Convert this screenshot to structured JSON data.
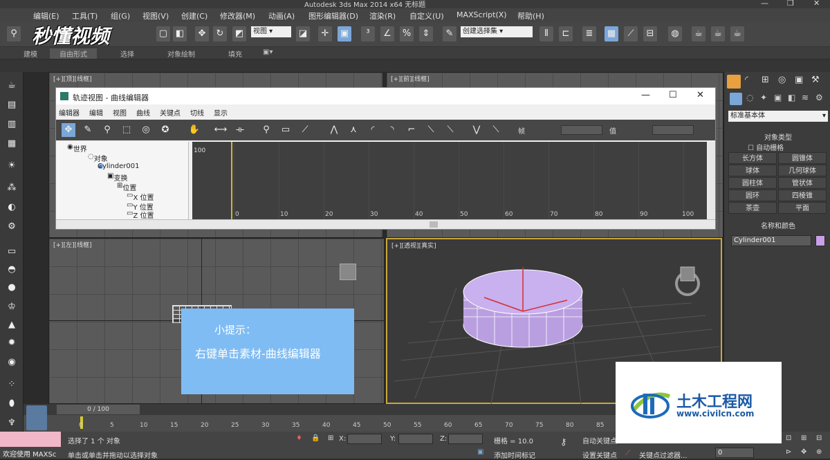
{
  "window": {
    "title": "Autodesk 3ds Max  2014 x64      无标题"
  },
  "menu": [
    "编辑(E)",
    "工具(T)",
    "组(G)",
    "视图(V)",
    "创建(C)",
    "修改器(M)",
    "动画(A)",
    "图形编辑器(D)",
    "渲染(R)",
    "自定义(U)",
    "MAXScript(X)",
    "帮助(H)"
  ],
  "toolbar": {
    "view_dropdown": "视图",
    "selection_set": "创建选择集"
  },
  "ribbon": {
    "tabs": [
      "建模",
      "自由形式",
      "选择",
      "对象绘制",
      "填充"
    ]
  },
  "watermark": "秒懂视频",
  "viewports": {
    "top_left": "[+][顶][线框]",
    "top_right": "[+][前][线框]",
    "bottom_left": "[+][左][线框]",
    "bottom_right": "[+][透视][真实]"
  },
  "dialog": {
    "title": "轨迹视图 - 曲线编辑器",
    "menu": [
      "编辑器",
      "编辑",
      "视图",
      "曲线",
      "关键点",
      "切线",
      "显示"
    ],
    "field_frame": "帧",
    "field_value": "值",
    "tree": [
      "世界",
      "对象",
      "Cylinder001",
      "变换",
      "位置",
      "X 位置",
      "Y 位置",
      "Z 位置"
    ],
    "y_label": "100",
    "x_ticks": [
      "0",
      "10",
      "20",
      "30",
      "40",
      "50",
      "60",
      "70",
      "80",
      "90",
      "100"
    ]
  },
  "tip": {
    "line1": "小提示：",
    "line2": "右键单击素材-曲线编辑器"
  },
  "command_panel": {
    "dropdown": "标准基本体",
    "section_object_type": "对象类型",
    "autogrid": "自动栅格",
    "buttons": [
      "长方体",
      "圆锥体",
      "球体",
      "几何球体",
      "圆柱体",
      "管状体",
      "圆环",
      "四棱锥",
      "茶壶",
      "平面"
    ],
    "section_name_color": "名称和颜色",
    "object_name": "Cylinder001",
    "object_color": "#c9a0e8"
  },
  "timeline": {
    "frame": "0 / 100",
    "ticks": [
      "0",
      "5",
      "10",
      "15",
      "20",
      "25",
      "30",
      "35",
      "40",
      "45",
      "50",
      "55",
      "60",
      "65",
      "70",
      "75",
      "80",
      "85"
    ]
  },
  "status": {
    "welcome": "欢迎使用 MAXSc",
    "selected": "选择了 1 个 对象",
    "hint": "单击或单击并拖动以选择对象",
    "x_label": "X:",
    "y_label": "Y:",
    "z_label": "Z:",
    "grid": "栅格 = 10.0",
    "autokey": "自动关键点",
    "setkey": "设置关键点",
    "add_time_tag": "添加时间标记",
    "key_filter": "关键点过滤器...",
    "spinner": "0"
  },
  "logo": {
    "name": "土木工程网",
    "url": "www.civilcn.com"
  }
}
